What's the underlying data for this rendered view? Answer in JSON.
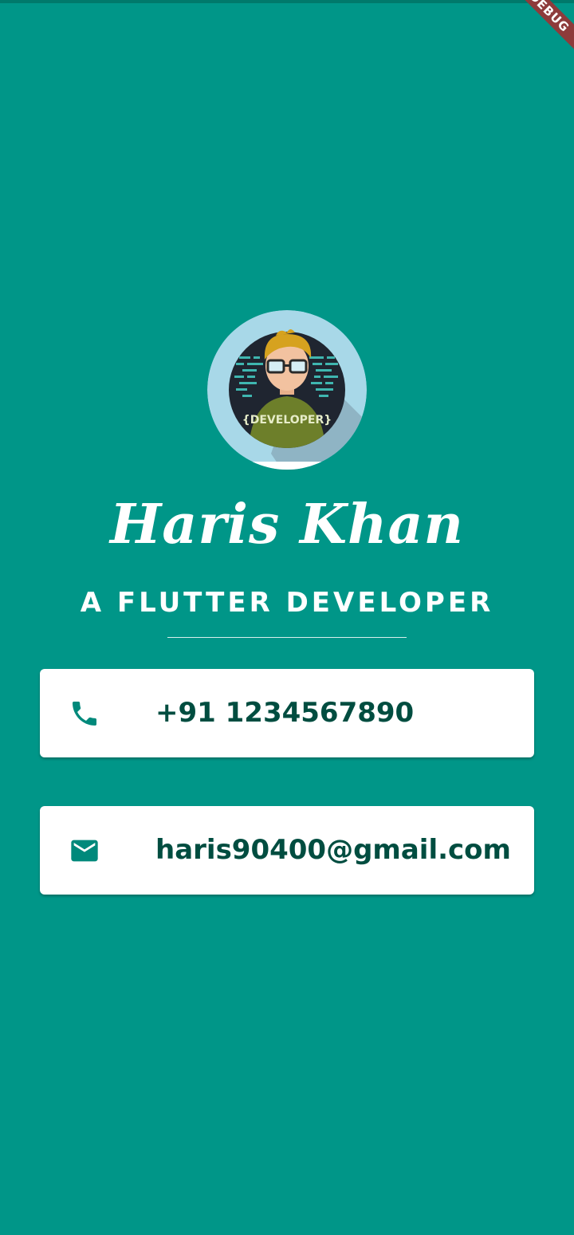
{
  "debug_banner": {
    "label": "DEBUG"
  },
  "profile": {
    "avatar_icon": "developer-avatar-icon",
    "avatar_badge": "{DEVELOPER}",
    "name": "Haris Khan",
    "title": "A FLUTTER DEVELOPER"
  },
  "contacts": {
    "phone": {
      "icon": "phone-icon",
      "value": "+91 1234567890"
    },
    "email": {
      "icon": "mail-icon",
      "value": "haris90400@gmail.com"
    }
  },
  "colors": {
    "background": "#009688",
    "card": "#ffffff",
    "icon": "#00897b",
    "card_text": "#004d40",
    "avatar_ring": "#a8d8e8",
    "banner": "#8e3b3b"
  }
}
